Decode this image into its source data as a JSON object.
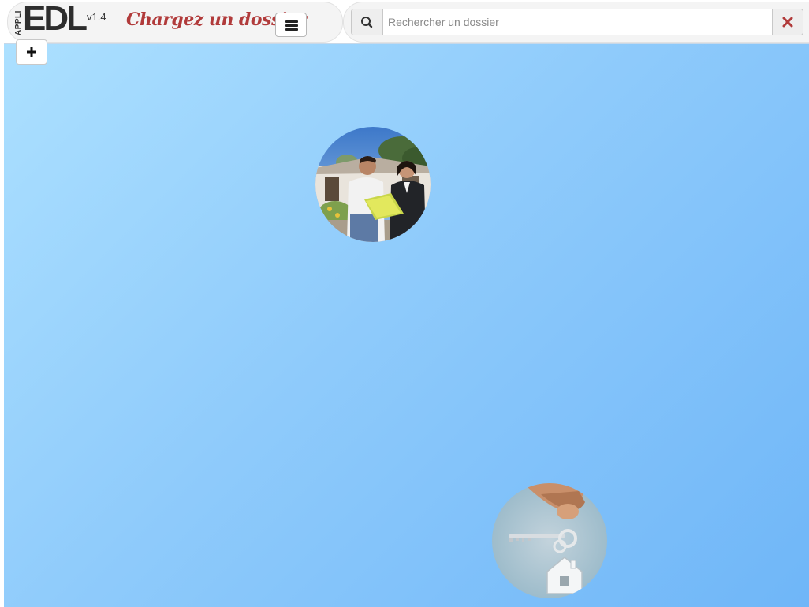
{
  "brand": {
    "prefix": "APPLI",
    "name": "EDL",
    "version": "v1.4"
  },
  "header": {
    "title": "Chargez un dossier",
    "menu_icon": "hamburger-icon"
  },
  "search": {
    "icon": "search-icon",
    "placeholder": "Rechercher un dossier",
    "value": "",
    "clear_icon": "close-icon"
  },
  "toolbar": {
    "add_icon": "plus-icon"
  },
  "bubbles": [
    {
      "name": "photo-agents-with-folder",
      "icon": "photo-agents"
    },
    {
      "name": "photo-house-keys",
      "icon": "photo-keys"
    }
  ],
  "colors": {
    "title": "#b13b3b",
    "clear": "#b13b3b",
    "background_light": "#ace0ff",
    "background_dark": "#6fb6f8"
  }
}
